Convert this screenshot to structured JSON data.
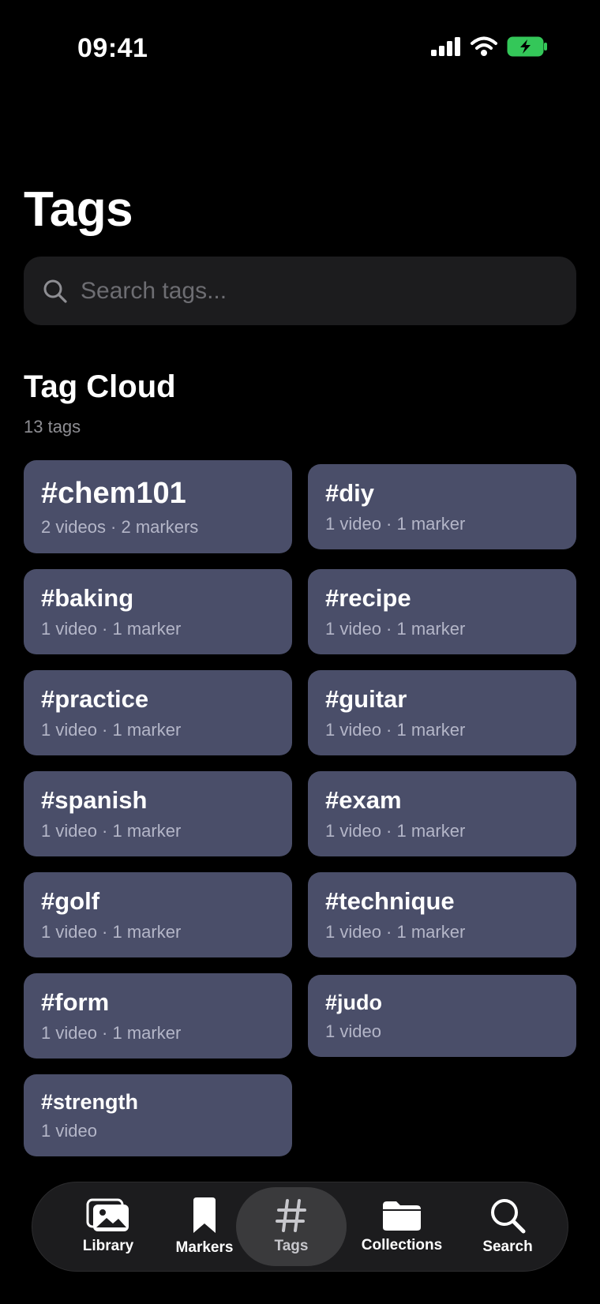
{
  "status": {
    "time": "09:41"
  },
  "page": {
    "title": "Tags"
  },
  "search": {
    "placeholder": "Search tags...",
    "value": ""
  },
  "cloud": {
    "title": "Tag Cloud",
    "count_label": "13 tags",
    "tags": [
      {
        "name": "#chem101",
        "meta": "2 videos · 2 markers"
      },
      {
        "name": "#diy",
        "meta": "1 video · 1 marker"
      },
      {
        "name": "#baking",
        "meta": "1 video · 1 marker"
      },
      {
        "name": "#recipe",
        "meta": "1 video · 1 marker"
      },
      {
        "name": "#practice",
        "meta": "1 video · 1 marker"
      },
      {
        "name": "#guitar",
        "meta": "1 video · 1 marker"
      },
      {
        "name": "#spanish",
        "meta": "1 video · 1 marker"
      },
      {
        "name": "#exam",
        "meta": "1 video · 1 marker"
      },
      {
        "name": "#golf",
        "meta": "1 video · 1 marker"
      },
      {
        "name": "#technique",
        "meta": "1 video · 1 marker"
      },
      {
        "name": "#form",
        "meta": "1 video · 1 marker"
      },
      {
        "name": "#judo",
        "meta": "1 video"
      },
      {
        "name": "#strength",
        "meta": "1 video"
      }
    ]
  },
  "tabs": [
    {
      "label": "Library",
      "icon": "photo-stack-icon"
    },
    {
      "label": "Markers",
      "icon": "bookmark-icon"
    },
    {
      "label": "Tags",
      "icon": "hashtag-icon",
      "active": true
    },
    {
      "label": "Collections",
      "icon": "folder-icon"
    },
    {
      "label": "Search",
      "icon": "search-icon"
    }
  ],
  "colors": {
    "card": "#4a4e69",
    "battery": "#34c759",
    "background": "#000000"
  }
}
